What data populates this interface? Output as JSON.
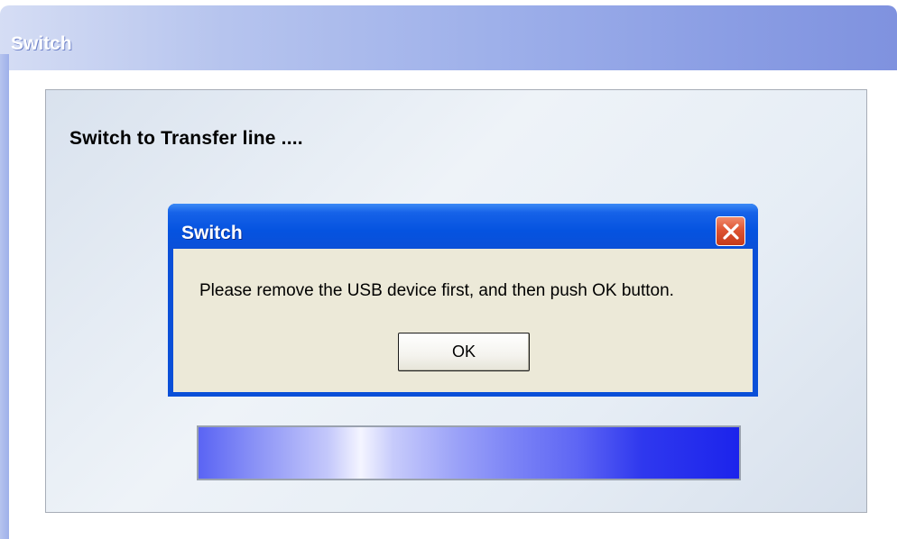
{
  "window": {
    "title": "Switch",
    "status_text": "Switch to Transfer line ...."
  },
  "progress": {
    "fill_fraction": 1.0,
    "colors": [
      "#5a64f4",
      "#f4f5ff",
      "#1c24ec"
    ]
  },
  "dialog": {
    "title": "Switch",
    "message": "Please remove the USB device first, and then push OK button.",
    "ok_label": "OK",
    "close_icon": "close-icon"
  },
  "colors": {
    "dialog_titlebar": "#0a4fd8",
    "dialog_body": "#ece9d8",
    "close_button": "#de5533"
  }
}
